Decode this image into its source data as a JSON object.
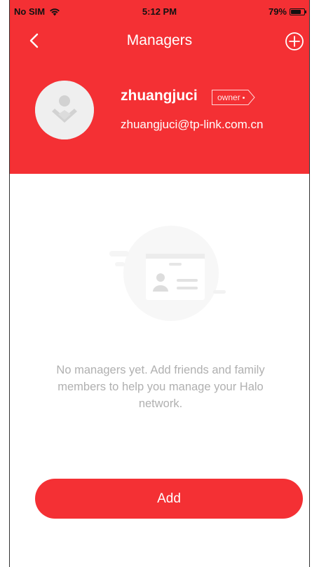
{
  "status_bar": {
    "carrier": "No SIM",
    "time": "5:12 PM",
    "battery": "79%",
    "battery_level": 0.79
  },
  "nav": {
    "title": "Managers",
    "back_icon": "chevron-left-icon",
    "add_icon": "circle-plus-icon"
  },
  "profile": {
    "name": "zhuangjuci",
    "role_tag": "owner",
    "email": "zhuangjuci@tp-link.com.cn",
    "avatar_icon": "default-avatar-icon"
  },
  "empty_state": {
    "illustration_icon": "id-card-icon",
    "message": "No managers yet. Add friends and family members to help you manage your Halo network."
  },
  "actions": {
    "add_label": "Add"
  },
  "colors": {
    "accent": "#f43034",
    "muted_text": "#b0b0b0"
  }
}
